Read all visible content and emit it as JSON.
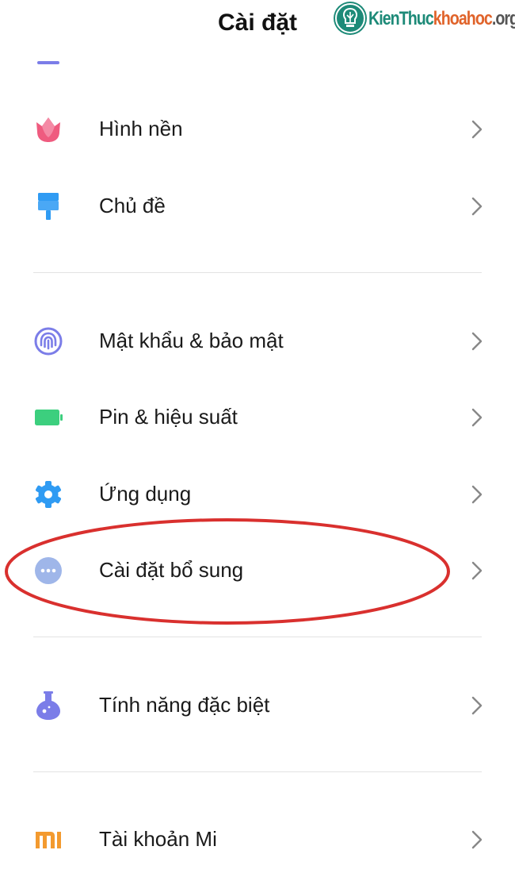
{
  "header": {
    "title": "Cài đặt"
  },
  "watermark": {
    "part1": "KienThuc",
    "part2": "khoahoc",
    "part3": ".org"
  },
  "settings": [
    {
      "label": "Hình nền",
      "icon": "tulip-icon",
      "color": "#ef5b7f"
    },
    {
      "label": "Chủ đề",
      "icon": "paint-roller-icon",
      "color": "#2f9bf3"
    },
    {
      "label": "Mật khẩu & bảo mật",
      "icon": "fingerprint-icon",
      "color": "#7b7de8"
    },
    {
      "label": "Pin & hiệu suất",
      "icon": "battery-icon",
      "color": "#3ccf7e"
    },
    {
      "label": "Ứng dụng",
      "icon": "gear-icon",
      "color": "#2f9bf3"
    },
    {
      "label": "Cài đặt bổ sung",
      "icon": "more-dots-icon",
      "color": "#9fb6e9"
    },
    {
      "label": "Tính năng đặc biệt",
      "icon": "potion-flask-icon",
      "color": "#7b7de8"
    },
    {
      "label": "Tài khoản Mi",
      "icon": "mi-logo-icon",
      "color": "#f39a2f"
    }
  ],
  "highlight_color": "#d9302e",
  "highlighted_item": "Cài đặt bổ sung"
}
